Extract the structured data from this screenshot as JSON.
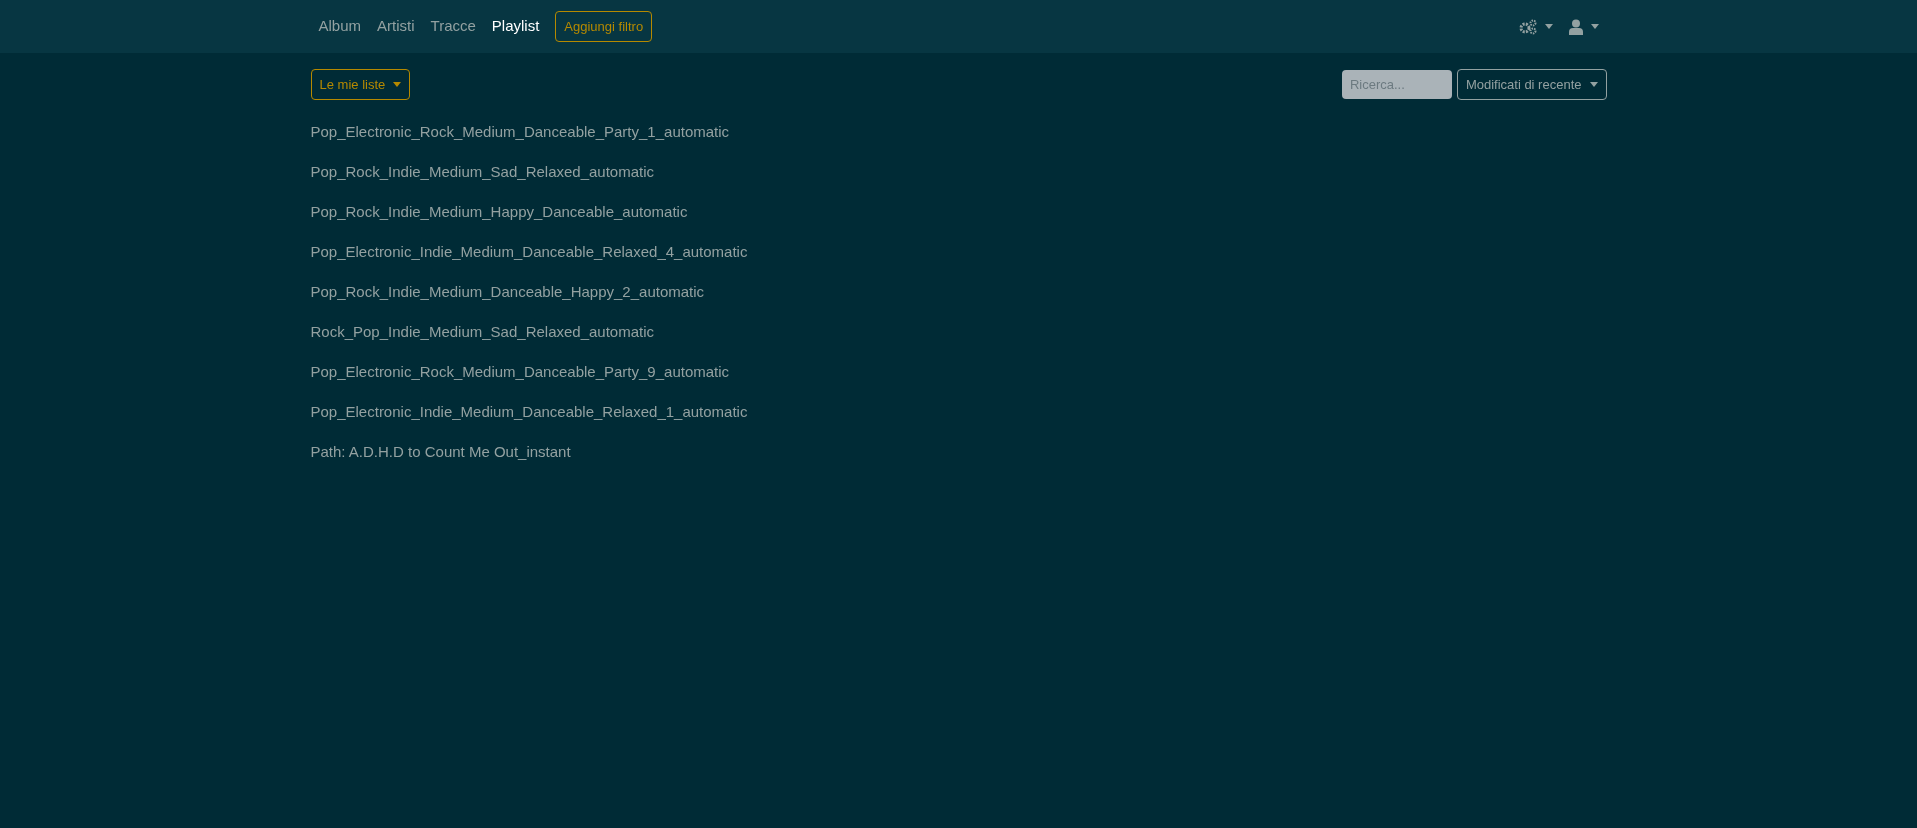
{
  "nav": {
    "tabs": [
      {
        "label": "Album",
        "selected": false
      },
      {
        "label": "Artisti",
        "selected": false
      },
      {
        "label": "Tracce",
        "selected": false
      },
      {
        "label": "Playlist",
        "selected": true
      }
    ],
    "filter_button": "Aggiungi filtro"
  },
  "toolbar": {
    "lists_button": "Le mie liste",
    "search": {
      "placeholder": "Ricerca..."
    },
    "sort_button": "Modificati di recente"
  },
  "playlists": [
    "Pop_Electronic_Rock_Medium_Danceable_Party_1_automatic",
    "Pop_Rock_Indie_Medium_Sad_Relaxed_automatic",
    "Pop_Rock_Indie_Medium_Happy_Danceable_automatic",
    "Pop_Electronic_Indie_Medium_Danceable_Relaxed_4_automatic",
    "Pop_Rock_Indie_Medium_Danceable_Happy_2_automatic",
    "Rock_Pop_Indie_Medium_Sad_Relaxed_automatic",
    "Pop_Electronic_Rock_Medium_Danceable_Party_9_automatic",
    "Pop_Electronic_Indie_Medium_Danceable_Relaxed_1_automatic",
    "Path: A.D.H.D to Count Me Out_instant"
  ]
}
